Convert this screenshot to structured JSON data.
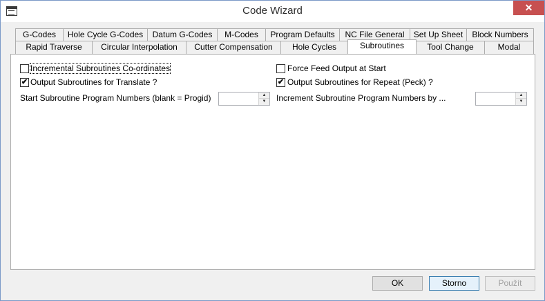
{
  "window": {
    "title": "Code Wizard",
    "close_label": "✕"
  },
  "tabs_row1": [
    {
      "label": "G-Codes"
    },
    {
      "label": "Hole Cycle G-Codes"
    },
    {
      "label": "Datum G-Codes"
    },
    {
      "label": "M-Codes"
    },
    {
      "label": "Program Defaults"
    },
    {
      "label": "NC File General"
    },
    {
      "label": "Set Up Sheet"
    },
    {
      "label": "Block Numbers"
    }
  ],
  "tabs_row2": [
    {
      "label": "Rapid Traverse"
    },
    {
      "label": "Circular Interpolation"
    },
    {
      "label": "Cutter Compensation"
    },
    {
      "label": "Hole Cycles"
    },
    {
      "label": "Subroutines",
      "selected": true
    },
    {
      "label": "Tool Change"
    },
    {
      "label": "Modal"
    }
  ],
  "subroutines": {
    "incremental_coords": {
      "label": "Incremental Subroutines Co-ordinates",
      "checked": false
    },
    "force_feed": {
      "label": "Force Feed Output at Start",
      "checked": false
    },
    "output_translate": {
      "label": "Output Subroutines for Translate ?",
      "checked": true
    },
    "output_repeat": {
      "label": "Output Subroutines for Repeat (Peck) ?",
      "checked": true
    },
    "start_numbers": {
      "label": "Start Subroutine Program Numbers (blank = Progid)",
      "value": ""
    },
    "increment_numbers": {
      "label": "Increment Subroutine Program Numbers by ...",
      "value": ""
    },
    "check_mark": "✔"
  },
  "buttons": {
    "ok": "OK",
    "cancel": "Storno",
    "apply": "Použít"
  },
  "colors": {
    "close_button": "#c75050",
    "window_border": "#7a98c7",
    "default_button_border": "#3c7fb1"
  }
}
